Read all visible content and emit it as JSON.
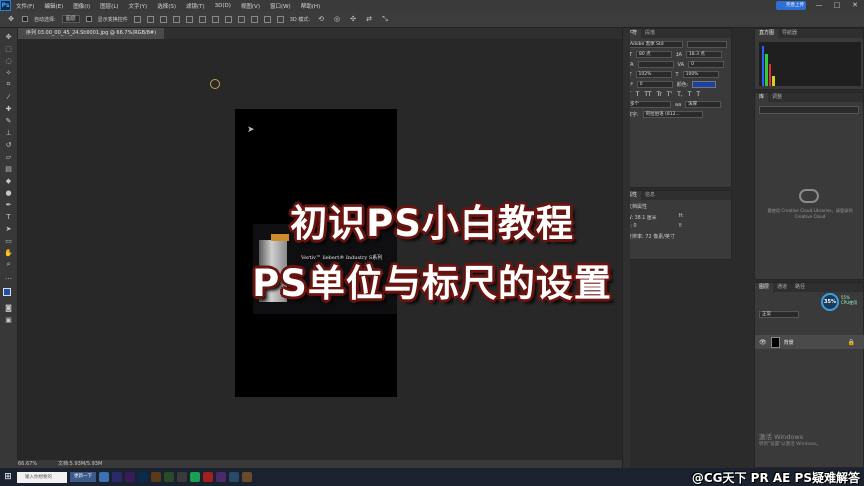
{
  "app": {
    "logo": "Ps",
    "menu": [
      "文件(F)",
      "编辑(E)",
      "图像(I)",
      "图层(L)",
      "文字(Y)",
      "选择(S)",
      "滤镜(T)",
      "3D(D)",
      "视图(V)",
      "窗口(W)",
      "帮助(H)"
    ],
    "window_controls": [
      "—",
      "□",
      "✕"
    ],
    "cloud_badge": "完善上传"
  },
  "options": {
    "auto_select_label": "自动选择:",
    "auto_select_value": "图层",
    "show_transform_label": "显示变换控件",
    "mode_3d_label": "3D 模式:"
  },
  "document": {
    "tab_title": "序列 03.00_00_45_24.Still001.jpg @ 66.7%(RGB/8#)",
    "product_text": "Vertiv™ liebert® Industry S系列"
  },
  "overlay": {
    "line1": "初识PS小白教程",
    "line2": "PS单位与标尺的设置"
  },
  "status": {
    "zoom": "66.67%",
    "doc_size": "文档:5.93M/5.93M"
  },
  "character_panel": {
    "tabs": [
      "字符",
      "段落"
    ],
    "font_family": "Adobe 黑体 Std",
    "font_size": "80 点",
    "leading": "18.3 点",
    "tracking": "0",
    "vertical_scale": "102%",
    "horizontal_scale": "100%",
    "color_label": "颜色:",
    "style_buttons": [
      "T",
      "T",
      "TT",
      "Tr",
      "T'",
      "T,",
      "T",
      "T"
    ],
    "language": "多个",
    "antialias": "浑厚",
    "baseline": "0",
    "number_label": "数字:",
    "number_value": "阿拉伯语 (812..."
  },
  "properties_panel": {
    "tabs": [
      "属性",
      "信息"
    ],
    "doc_props": "文档属性",
    "width_label": "W:",
    "width_value": "38.1 厘米",
    "height_label": "H:",
    "x_label": "X:",
    "x_value": "0",
    "y_label": "Y:",
    "resolution": "分辨率: 72 像素/英寸"
  },
  "histogram_panel": {
    "tabs": [
      "直方图",
      "导航器"
    ]
  },
  "library_panel": {
    "tabs": [
      "库",
      "调整"
    ],
    "cc_text": "要使用 Creative Cloud Libraries，请登录到 Creative Cloud"
  },
  "layers_panel": {
    "tabs": [
      "图层",
      "通道",
      "路径"
    ],
    "blend_mode": "正常",
    "layer_name": "背景",
    "gauge_percent": "35%",
    "gauge_info_1": "55%",
    "gauge_info_2": "CPU使用",
    "activate_title": "激活 Windows",
    "activate_sub": "转到\"设置\"以激活 Windows。"
  },
  "taskbar": {
    "search_placeholder": "输入你想要的",
    "pill_label": "更新一下",
    "watermark": "@CG天下 PR AE PS疑难解答"
  },
  "colors": {
    "foreground": "#1e4fb5",
    "background": "#ffffff",
    "text_color_chip": "#1d3fa8",
    "title_outline": "#6a1410"
  }
}
